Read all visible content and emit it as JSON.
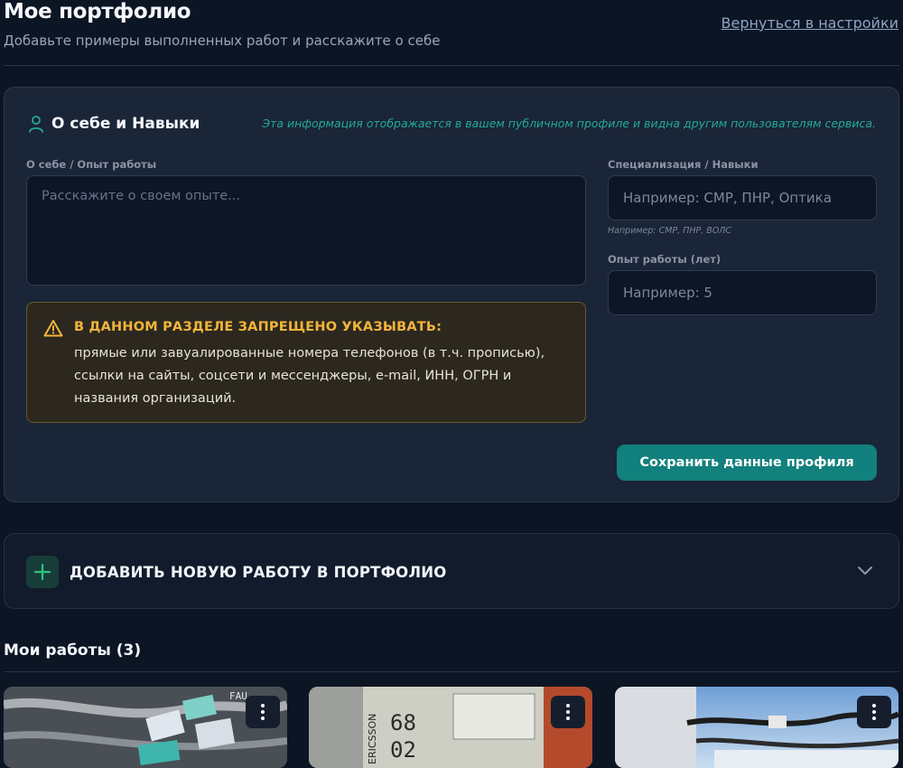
{
  "header": {
    "title": "Мое портфолио",
    "subtitle": "Добавьте примеры выполненных работ и расскажите о себе",
    "back_link": "Вернуться в настройки"
  },
  "profile": {
    "title": "О себе и Навыки",
    "note": "Эта информация отображается в вашем публичном профиле и видна другим пользователям сервиса.",
    "about_label": "О себе / Опыт работы",
    "about_placeholder": "Расскажите о своем опыте...",
    "about_value": "",
    "spec_label": "Специализация / Навыки",
    "spec_placeholder": "Например: СМР, ПНР, Оптика",
    "spec_value": "",
    "spec_hint": "Например: СМР, ПНР, ВОЛС",
    "exp_label": "Опыт работы (лет)",
    "exp_placeholder": "Например: 5",
    "exp_value": "",
    "warning_title": "В ДАННОМ РАЗДЕЛЕ ЗАПРЕЩЕНО УКАЗЫВАТЬ:",
    "warning_text": "прямые или завуалированные номера телефонов (в т.ч. прописью), ссылки на сайты, соцсети и мессенджеры, e-mail, ИНН, ОГРН и названия организаций.",
    "save_label": "Сохранить данные профиля"
  },
  "add_work": {
    "title": "ДОБАВИТЬ НОВУЮ РАБОТУ В ПОРТФОЛИО",
    "icon": "plus-icon",
    "expand_icon": "chevron-down-icon"
  },
  "works": {
    "title": "Мои работы (3)",
    "items": [
      {
        "thumb_label": "FAU"
      },
      {
        "thumb_label": "ERICSSON"
      },
      {
        "thumb_label": ""
      }
    ]
  },
  "colors": {
    "background": "#0c1524",
    "card": "#1a2537",
    "accent": "#12807c",
    "note": "#23a99a",
    "warning": "#f2b53a"
  }
}
